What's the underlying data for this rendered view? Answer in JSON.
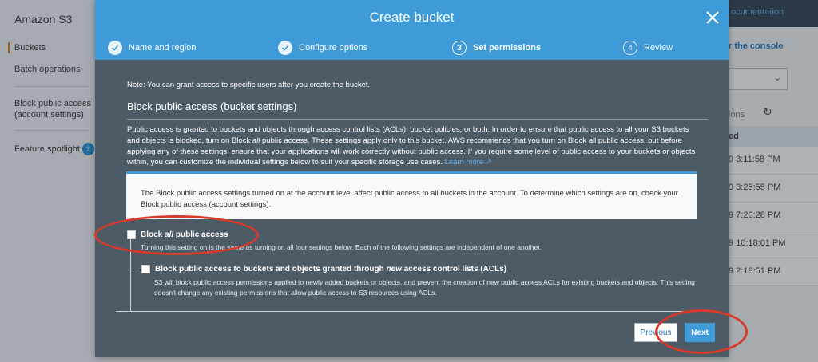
{
  "background": {
    "app_title": "Amazon S3",
    "sidebar": [
      {
        "label": "Buckets"
      },
      {
        "label": "Batch operations"
      },
      {
        "label": "Block public access (account settings)"
      },
      {
        "label": "Feature spotlight",
        "badge": "2"
      }
    ],
    "documentation_label": "ocumentation",
    "console_link": "r the console",
    "options_label": "ions",
    "column_header": "ed",
    "rows": [
      "9 3:11:58 PM",
      "9 3:25:55 PM",
      "9 7:26:28 PM",
      "9 10:18:01 PM",
      "9 2:18:51 PM"
    ]
  },
  "modal": {
    "title": "Create bucket",
    "close_icon": "close-icon",
    "steps": [
      {
        "number": "1",
        "label": "Name and region",
        "state": "done"
      },
      {
        "number": "2",
        "label": "Configure options",
        "state": "done"
      },
      {
        "number": "3",
        "label": "Set permissions",
        "state": "current"
      },
      {
        "number": "4",
        "label": "Review",
        "state": "future"
      }
    ],
    "note": "Note: You can grant access to specific users after you create the bucket.",
    "section_title": "Block public access (bucket settings)",
    "description_before": "Public access is granted to buckets and objects through access control lists (ACLs), bucket policies, or both. In order to ensure that public access to all your S3 buckets and objects is blocked, turn on Block ",
    "description_em": "all",
    "description_after": " public access. These settings apply only to this bucket. AWS recommends that you turn on Block all public access, but before applying any of these settings, ensure that your applications will work correctly without public access. If you require some level of public access to your buckets or objects within, you can customize the individual settings below to suit your specific storage use cases. ",
    "learn_more": "Learn more",
    "info_box": "The Block public access settings turned on at the account level affect public access to all buckets in the account. To determine which settings are on, check your Block public access (account settings).",
    "block_all": {
      "label_before": "Block ",
      "label_em": "all",
      "label_after": " public access",
      "checked": false,
      "sub": "Turning this setting on is the same as turning on all four settings below. Each of the following settings are independent of one another."
    },
    "block_new_acl": {
      "label_before": "Block public access to buckets and objects granted through ",
      "label_em": "new",
      "label_after": " access control lists (ACLs)",
      "checked": false,
      "sub": "S3 will block public access permissions applied to newly added buckets or objects, and prevent the creation of new public access ACLs for existing buckets and objects. This setting doesn't change any existing permissions that allow public access to S3 resources using ACLs."
    },
    "previous_label": "Previous",
    "next_label": "Next"
  },
  "colors": {
    "header": "#3f9ad8",
    "modal_body": "#4d5b67",
    "annotation": "#d63a2a",
    "link": "#5fb0ee"
  }
}
